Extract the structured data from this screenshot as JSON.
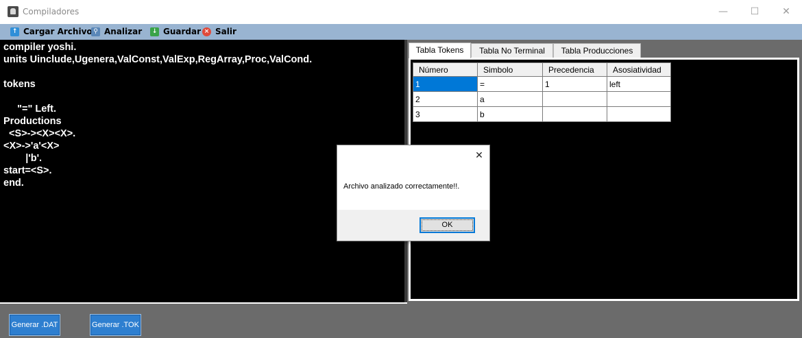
{
  "window": {
    "title": "Compiladores",
    "icon": "app-icon",
    "controls": {
      "minimize": "—",
      "maximize": "☐",
      "close": "✕"
    }
  },
  "menu": {
    "items": [
      {
        "label": "Cargar Archivo",
        "icon": "upload-icon",
        "color": "#2f8fd8"
      },
      {
        "label": "Analizar",
        "icon": "magnifier-icon",
        "color": "#5a87b8"
      },
      {
        "label": "Guardar",
        "icon": "save-icon",
        "color": "#3aa348"
      },
      {
        "label": "Salir",
        "icon": "exit-icon",
        "color": "#e04a3a"
      }
    ]
  },
  "editor": {
    "content": "compiler yoshi.\nunits Uinclude,Ugenera,ValConst,ValExp,RegArray,Proc,ValCond.\n\ntokens\n\n     \"=\" Left.\nProductions\n  <S>-><X><X>.\n<X>->'a'<X>\n        |'b'.\nstart=<S>.\nend."
  },
  "tabs": [
    {
      "label": "Tabla Tokens",
      "active": true
    },
    {
      "label": "Tabla No Terminal",
      "active": false
    },
    {
      "label": "Tabla Producciones",
      "active": false
    }
  ],
  "grid": {
    "columns": [
      "Número",
      "Simbolo",
      "Precedencia",
      "Asosiatividad"
    ],
    "rows": [
      [
        "1",
        "=",
        "1",
        "left"
      ],
      [
        "2",
        "a",
        "",
        ""
      ],
      [
        "3",
        "b",
        "",
        ""
      ]
    ],
    "selected_row": 0
  },
  "buttons": {
    "gen_dat": "Generar .DAT",
    "gen_tok": "Generar .TOK"
  },
  "dialog": {
    "message": "Archivo analizado correctamente!!.",
    "ok": "OK",
    "close": "✕"
  },
  "colors": {
    "menubar": "#99b4d1",
    "selection": "#0078d7",
    "button": "#2e7fd0"
  }
}
